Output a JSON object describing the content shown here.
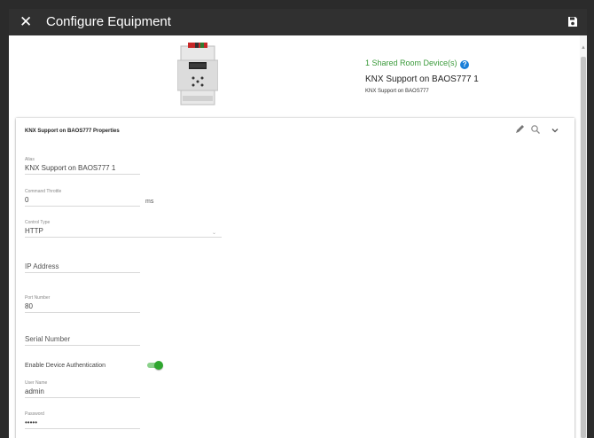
{
  "window": {
    "title": "Configure Equipment",
    "close_icon": "close-icon",
    "save_icon": "save-icon"
  },
  "device": {
    "image_icon": "din-rail-device-image",
    "shared_label": "1 Shared Room Device(s)",
    "help_glyph": "?",
    "name": "KNX Support on BAOS777 1",
    "subtitle": "KNX Support on BAOS777"
  },
  "properties": {
    "title": "KNX Support on BAOS777 Properties",
    "tools": [
      "edit-icon",
      "search-icon",
      "chevron-down-icon"
    ],
    "alias": {
      "label": "Alias",
      "value": "KNX Support on BAOS777 1"
    },
    "command_throttle": {
      "label": "Command Throttle",
      "value": "0",
      "unit": "ms"
    },
    "control_type": {
      "label": "Control Type",
      "value": "HTTP"
    },
    "ip_address": {
      "placeholder": "IP Address"
    },
    "port_number": {
      "label": "Port Number",
      "value": "80"
    },
    "serial_number": {
      "placeholder": "Serial Number"
    },
    "enable_auth": {
      "label": "Enable Device Authentication",
      "enabled": true
    },
    "user_name": {
      "label": "User Name",
      "value": "admin"
    },
    "password": {
      "label": "Password",
      "value": "•••••"
    }
  },
  "colors": {
    "titlebar": "#303030",
    "accent_green": "#3a9a3a",
    "help_blue": "#1a7fd9",
    "toggle_on": "#2fa62f"
  }
}
